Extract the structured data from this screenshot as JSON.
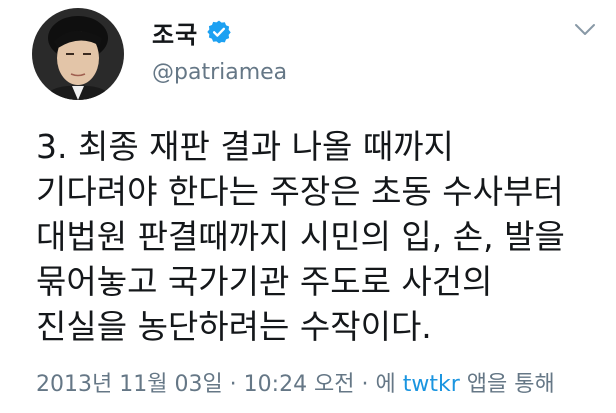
{
  "tweet": {
    "author": {
      "display_name": "조국",
      "handle": "@patriamea",
      "verified": true
    },
    "text_lines": [
      "3. 최종 재판 결과 나올 때까지",
      "기다려야 한다는 주장은 초동 수사부터",
      "대법원 판결때까지 시민의 입, 손, 발을",
      "묶어놓고 국가기관 주도로 사건의",
      "진실을 농단하려는 수작이다."
    ],
    "meta": {
      "timestamp": "2013년 11월 03일 · 10:24 오전 · 에",
      "client": "twtkr",
      "suffix": "앱을 통해"
    }
  },
  "colors": {
    "verified_badge": "#1da1f2",
    "secondary_text": "#657786",
    "link": "#1b95e0"
  },
  "icons": {
    "verified": "verified-badge-icon",
    "menu": "chevron-down-icon"
  }
}
